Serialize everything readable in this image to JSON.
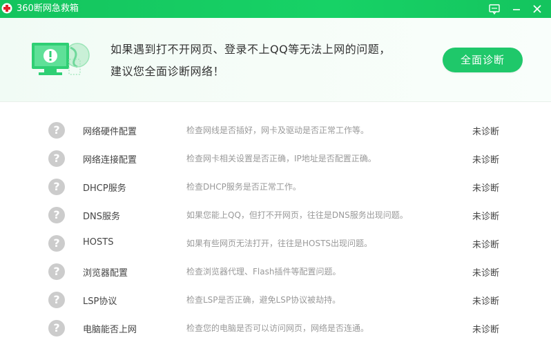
{
  "window": {
    "title": "360断网急救箱",
    "accent_color": "#17d266",
    "icons": [
      "red-cross-logo-icon",
      "feedback-icon",
      "minimize-icon",
      "close-icon"
    ]
  },
  "banner": {
    "line1": "如果遇到打不开网页、登录不上QQ等无法上网的问题，",
    "line2": "建议您全面诊断网络！",
    "button_label": "全面诊断",
    "button_color": "#1fc86a"
  },
  "checks": [
    {
      "name": "网络硬件配置",
      "desc": "检查网线是否插好，网卡及驱动是否正常工作等。",
      "status": "未诊断"
    },
    {
      "name": "网络连接配置",
      "desc": "检查网卡相关设置是否正确，IP地址是否配置正确。",
      "status": "未诊断"
    },
    {
      "name": "DHCP服务",
      "desc": "检查DHCP服务是否正常工作。",
      "status": "未诊断"
    },
    {
      "name": "DNS服务",
      "desc": "如果您能上QQ，但打不开网页，往往是DNS服务出现问题。",
      "status": "未诊断"
    },
    {
      "name": "HOSTS",
      "desc": "如果有些网页无法打开，往往是HOSTS出现问题。",
      "status": "未诊断"
    },
    {
      "name": "浏览器配置",
      "desc": "检查浏览器代理、Flash插件等配置问题。",
      "status": "未诊断"
    },
    {
      "name": "LSP协议",
      "desc": "检查LSP是否正确，避免LSP协议被劫持。",
      "status": "未诊断"
    },
    {
      "name": "电脑能否上网",
      "desc": "检查您的电脑是否可以访问网页，网络是否连通。",
      "status": "未诊断"
    }
  ]
}
